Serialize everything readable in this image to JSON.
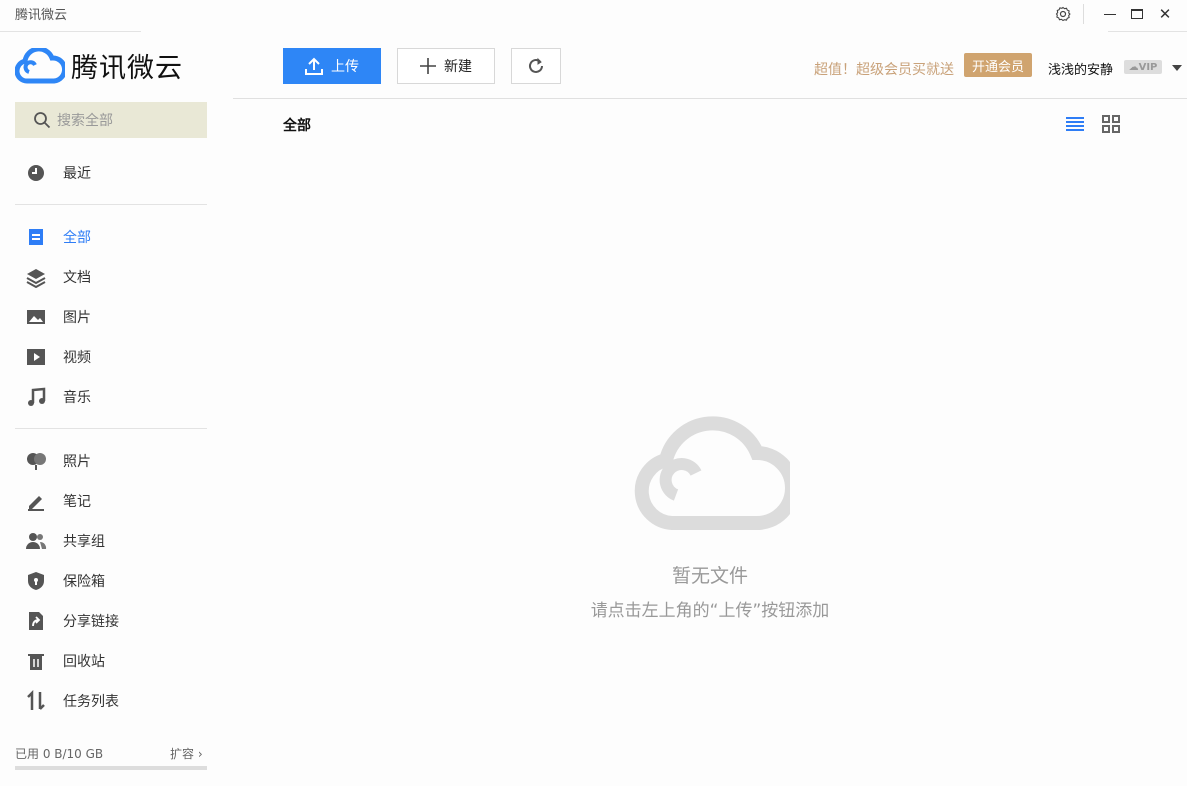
{
  "window": {
    "title": "腾讯微云"
  },
  "logo": {
    "text": "腾讯微云",
    "color": "#2e86f6"
  },
  "search": {
    "placeholder": "搜索全部"
  },
  "sidebar": {
    "items": [
      {
        "label": "最近",
        "icon": "clock-icon"
      },
      {
        "label": "全部",
        "icon": "file-icon",
        "active": true
      },
      {
        "label": "文档",
        "icon": "layers-icon"
      },
      {
        "label": "图片",
        "icon": "image-icon"
      },
      {
        "label": "视频",
        "icon": "play-icon"
      },
      {
        "label": "音乐",
        "icon": "music-icon"
      },
      {
        "label": "照片",
        "icon": "balloon-icon"
      },
      {
        "label": "笔记",
        "icon": "pencil-icon"
      },
      {
        "label": "共享组",
        "icon": "users-icon"
      },
      {
        "label": "保险箱",
        "icon": "shield-icon"
      },
      {
        "label": "分享链接",
        "icon": "share-icon"
      },
      {
        "label": "回收站",
        "icon": "trash-icon"
      },
      {
        "label": "任务列表",
        "icon": "transfer-icon"
      }
    ],
    "storage": {
      "used": "已用 0 B/10 GB",
      "expand": "扩容",
      "fraction": 0
    }
  },
  "toolbar": {
    "upload": "上传",
    "new": "新建"
  },
  "header": {
    "promo": "超值！超级会员买就送",
    "vip_button": "开通会员",
    "username": "浅浅的安静",
    "vip_badge": "VIP"
  },
  "main": {
    "breadcrumb": "全部",
    "empty_title": "暂无文件",
    "empty_hint": "请点击左上角的“上传”按钮添加"
  }
}
